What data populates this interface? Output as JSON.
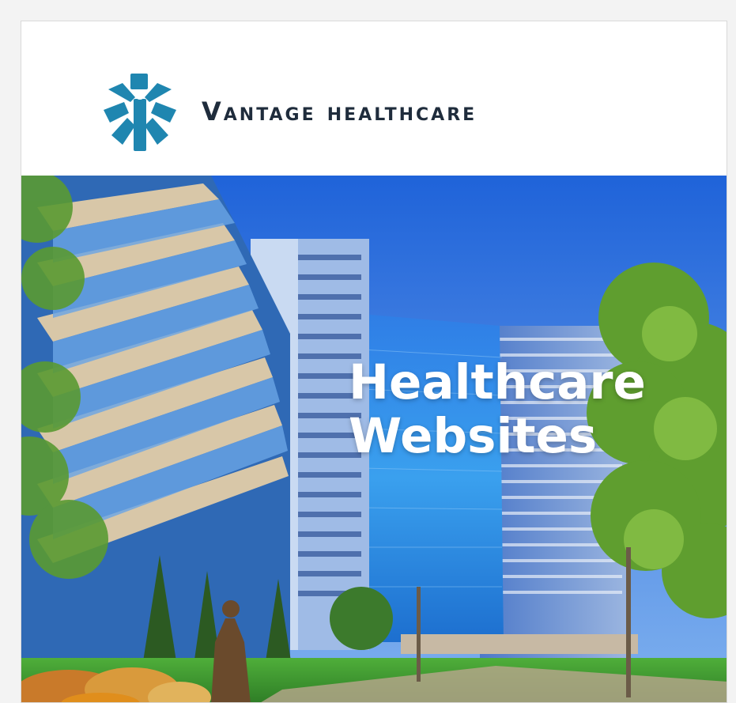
{
  "brand": {
    "name": "Vantage healthcare",
    "logo_icon": "star-of-life-figure-icon",
    "color": "#1f86b0"
  },
  "hero": {
    "title_line1": "Healthcare",
    "title_line2": "Websites"
  }
}
